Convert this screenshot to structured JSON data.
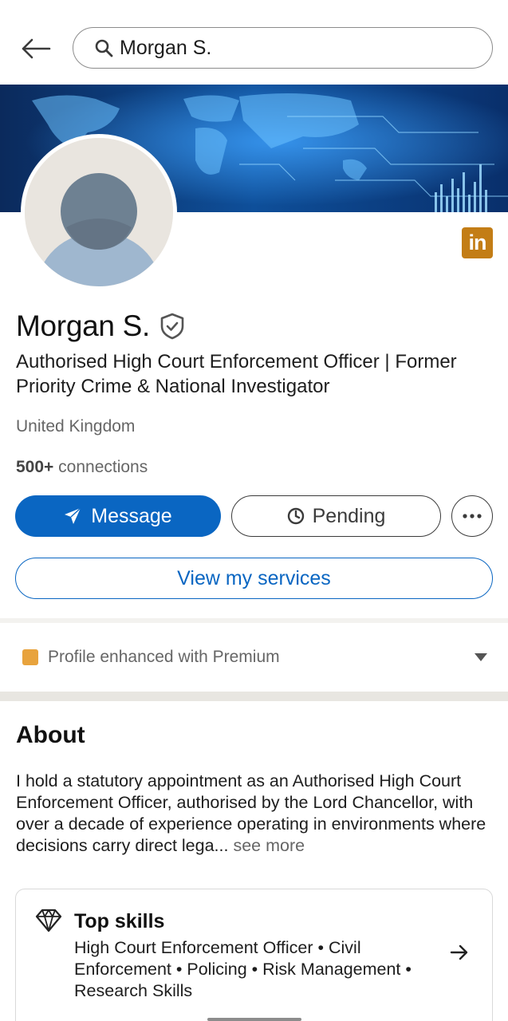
{
  "search": {
    "query": "Morgan S."
  },
  "profile": {
    "name": "Morgan S.",
    "headline": "Authorised High Court Enforcement Officer | Former Priority Crime & National Investigator",
    "location": "United Kingdom",
    "connections_count": "500+",
    "connections_label": "connections",
    "badge_text": "in"
  },
  "actions": {
    "message_label": "Message",
    "pending_label": "Pending",
    "services_label": "View my services"
  },
  "premium": {
    "label": "Profile enhanced with Premium"
  },
  "about": {
    "title": "About",
    "text": "I hold a statutory appointment as an Authorised High Court Enforcement Officer, authorised by the Lord Chancellor, with over a decade of experience operating in environments where decisions carry direct lega...",
    "see_more": "see more"
  },
  "skills": {
    "title": "Top skills",
    "list": "High Court Enforcement Officer • Civil Enforcement  • Policing • Risk Management • Research Skills"
  },
  "colors": {
    "primary": "#0a66c2",
    "premium": "#e8a33d",
    "linkedin_badge": "#c37d16"
  }
}
